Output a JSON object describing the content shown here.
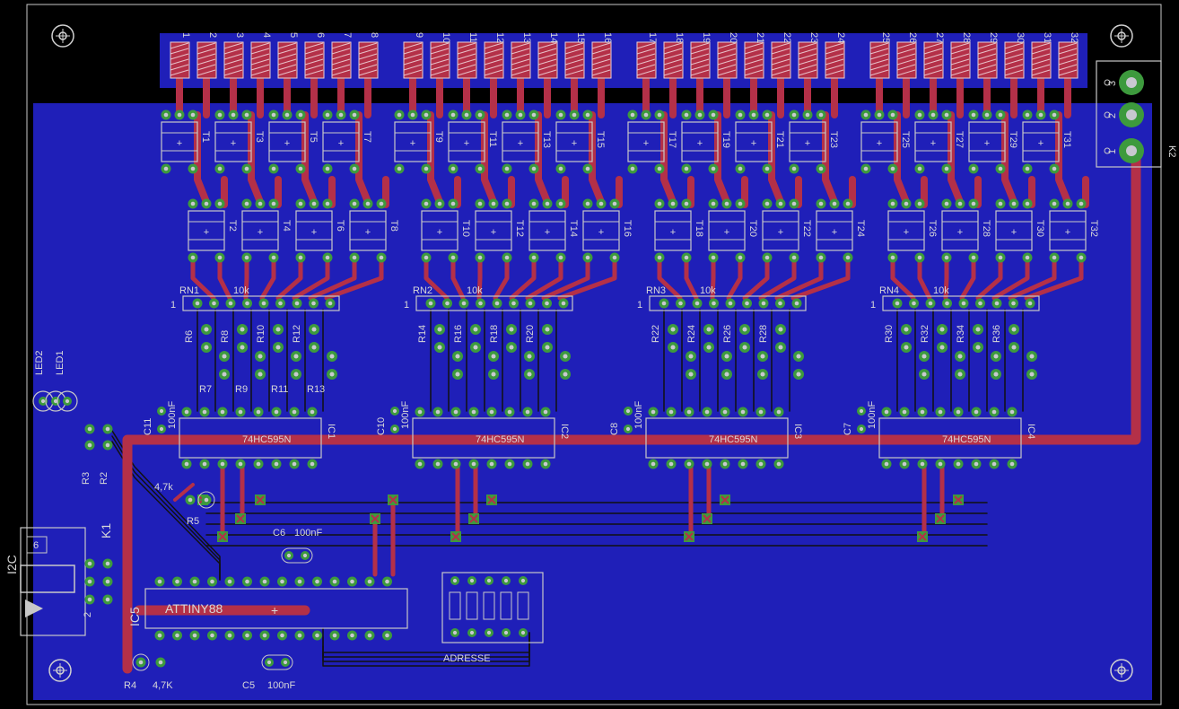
{
  "colors": {
    "background": "#000000",
    "copper_bottom": "#1f1fb8",
    "copper_top": "#b43048",
    "pad": "#3d9a3d",
    "pad_center": "#c8c8d0",
    "outline": "#c8c8c8",
    "label": "#d8d8d8"
  },
  "channel_numbers": [
    "1",
    "2",
    "3",
    "4",
    "5",
    "6",
    "7",
    "8",
    "9",
    "10",
    "11",
    "12",
    "13",
    "14",
    "15",
    "16",
    "17",
    "18",
    "19",
    "20",
    "21",
    "22",
    "23",
    "24",
    "25",
    "26",
    "27",
    "28",
    "29",
    "30",
    "31",
    "32"
  ],
  "transistor_labels": [
    "T1",
    "T2",
    "T3",
    "T4",
    "T5",
    "T6",
    "T7",
    "T8",
    "T9",
    "T10",
    "T11",
    "T12",
    "T13",
    "T14",
    "T15",
    "T16",
    "T17",
    "T18",
    "T19",
    "T20",
    "T21",
    "T22",
    "T23",
    "T24",
    "T25",
    "T26",
    "T27",
    "T28",
    "T29",
    "T30",
    "T31",
    "T32"
  ],
  "resistor_networks": [
    {
      "name": "RN1",
      "value": "10k",
      "pin1": "1"
    },
    {
      "name": "RN2",
      "value": "10k",
      "pin1": "1"
    },
    {
      "name": "RN3",
      "value": "10k",
      "pin1": "1"
    },
    {
      "name": "RN4",
      "value": "10k",
      "pin1": "1"
    }
  ],
  "resistor_groups": [
    {
      "upper": [
        "R6",
        "R8",
        "R10",
        "R12"
      ],
      "lower": [
        "R7",
        "R9",
        "R11",
        "R13"
      ]
    },
    {
      "upper": [
        "R14",
        "R16",
        "R18",
        "R20"
      ],
      "lower": []
    },
    {
      "upper": [
        "R22",
        "R24",
        "R26",
        "R28"
      ],
      "lower": []
    },
    {
      "upper": [
        "R30",
        "R32",
        "R34",
        "R36"
      ],
      "lower": []
    }
  ],
  "shift_registers": [
    {
      "ic": "IC1",
      "part": "74HC595N",
      "cap": "C11",
      "cap_value": "100nF"
    },
    {
      "ic": "IC2",
      "part": "74HC595N",
      "cap": "C10",
      "cap_value": "100nF"
    },
    {
      "ic": "IC3",
      "part": "74HC595N",
      "cap": "C8",
      "cap_value": "100nF"
    },
    {
      "ic": "IC4",
      "part": "74HC595N",
      "cap": "C7",
      "cap_value": "100nF"
    }
  ],
  "leds": [
    "LED2",
    "LED1"
  ],
  "pullups": [
    "R3",
    "R2"
  ],
  "r5": {
    "name": "R5",
    "value": "4,7k"
  },
  "c6": {
    "name": "C6",
    "value": "100nF"
  },
  "mcu": {
    "ic": "IC5",
    "part": "ATTINY88"
  },
  "i2c": {
    "label": "I2C",
    "connector": "K1",
    "pin_top": "6",
    "pin_bottom": "2"
  },
  "r4": {
    "name": "R4",
    "value": "4,7K"
  },
  "c5": {
    "name": "C5",
    "value": "100nF"
  },
  "dip": {
    "label": "ADRESSE"
  },
  "k2": {
    "name": "K2",
    "pins": [
      "3",
      "2",
      "1"
    ]
  }
}
